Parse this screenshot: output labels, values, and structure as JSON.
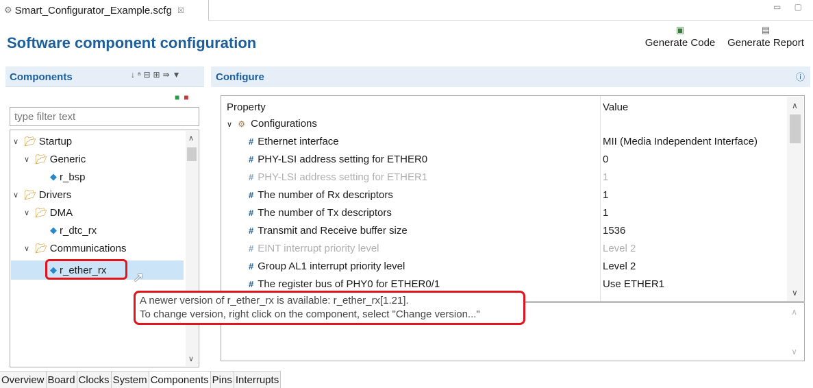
{
  "editor": {
    "tab_title": "Smart_Configurator_Example.scfg",
    "close_glyph": "☒",
    "window_controls": "▭ ▢"
  },
  "page": {
    "title": "Software component configuration"
  },
  "toolbar": {
    "generate_code_label": "Generate Code",
    "generate_report_label": "Generate Report",
    "generate_code_icon": "generate-code-icon",
    "generate_report_icon": "printer-icon"
  },
  "components": {
    "title": "Components",
    "filter_placeholder": "type filter text",
    "tree": [
      {
        "label": "Startup",
        "level": 0,
        "kind": "folder",
        "expanded": true
      },
      {
        "label": "Generic",
        "level": 1,
        "kind": "folder",
        "expanded": true
      },
      {
        "label": "r_bsp",
        "level": 2,
        "kind": "component"
      },
      {
        "label": "Drivers",
        "level": 0,
        "kind": "folder",
        "expanded": true
      },
      {
        "label": "DMA",
        "level": 1,
        "kind": "folder",
        "expanded": true
      },
      {
        "label": "r_dtc_rx",
        "level": 2,
        "kind": "component"
      },
      {
        "label": "Communications",
        "level": 1,
        "kind": "folder",
        "expanded": true
      },
      {
        "label": "r_ether_rx",
        "level": 2,
        "kind": "component",
        "selected": true
      }
    ]
  },
  "configure": {
    "title": "Configure",
    "header_property": "Property",
    "header_value": "Value",
    "group_label": "Configurations",
    "rows": [
      {
        "property": "Ethernet interface",
        "value": "MII  (Media Independent Interface)",
        "enabled": true
      },
      {
        "property": "PHY-LSI address setting for ETHER0",
        "value": "0",
        "enabled": true
      },
      {
        "property": "PHY-LSI address setting for ETHER1",
        "value": "1",
        "enabled": false
      },
      {
        "property": "The number of Rx descriptors",
        "value": "1",
        "enabled": true
      },
      {
        "property": "The number of Tx descriptors",
        "value": "1",
        "enabled": true
      },
      {
        "property": "Transmit and Receive buffer size",
        "value": "1536",
        "enabled": true
      },
      {
        "property": "EINT interrupt priority level",
        "value": "Level 2",
        "enabled": false
      },
      {
        "property": "Group AL1 interrupt priority level",
        "value": "Level 2",
        "enabled": true
      },
      {
        "property": "The register bus of PHY0 for ETHER0/1",
        "value": "Use ETHER1",
        "enabled": true
      }
    ]
  },
  "tooltip": {
    "line1": "A newer version of r_ether_rx is available: r_ether_rx[1.21].",
    "line2": "To change version, right click on the component, select \"Change version...\""
  },
  "bottom_tabs": [
    "Overview",
    "Board",
    "Clocks",
    "System",
    "Components",
    "Pins",
    "Interrupts"
  ],
  "active_bottom_tab": "Components",
  "colors": {
    "accent": "#1c5f9a",
    "header_bg": "#e6eef8",
    "selection": "#cce4f7",
    "highlight_red": "#e0141a"
  }
}
